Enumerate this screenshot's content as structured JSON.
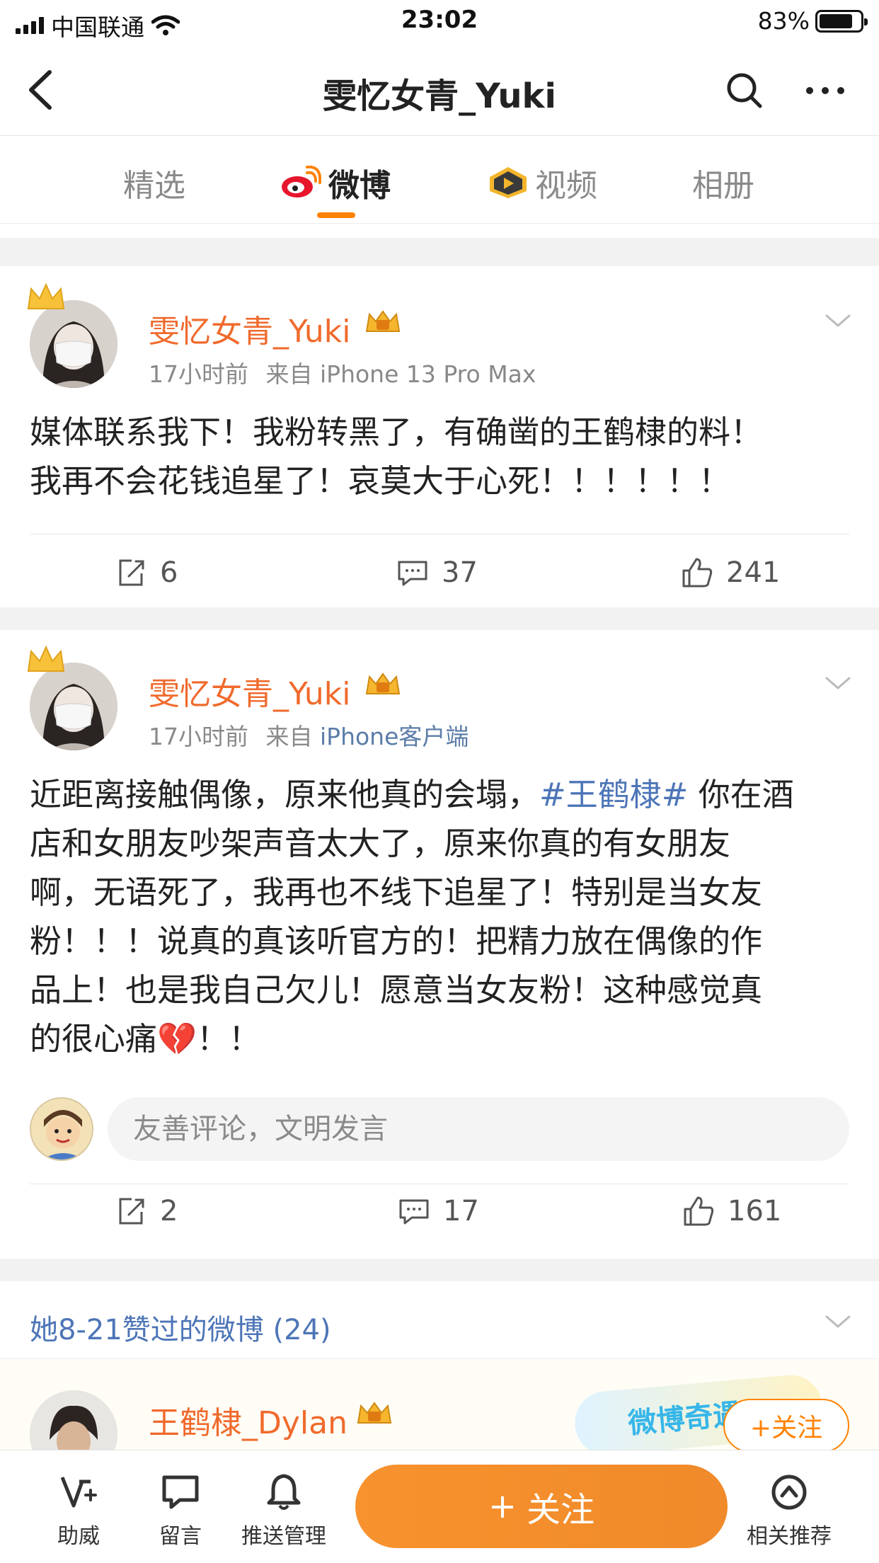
{
  "status_bar": {
    "carrier": "中国联通",
    "time": "23:02",
    "battery": "83%",
    "battery_level": 0.83
  },
  "header": {
    "title": "雯忆女青_Yuki"
  },
  "tabs": [
    {
      "label": "精选",
      "active": false
    },
    {
      "label": "微博",
      "active": true
    },
    {
      "label": "视频",
      "active": false
    },
    {
      "label": "相册",
      "active": false
    }
  ],
  "posts": [
    {
      "author": "雯忆女青_Yuki",
      "time": "17小时前",
      "source_prefix": "来自",
      "source": "iPhone 13 Pro Max",
      "text_lines": [
        "媒体联系我下！我粉转黑了，有确凿的王鹤棣的料！",
        "我再不会花钱追星了！哀莫大于心死！！！！！！"
      ],
      "reposts": "6",
      "comments": "37",
      "likes": "241"
    },
    {
      "author": "雯忆女青_Yuki",
      "time": "17小时前",
      "source_prefix": "来自",
      "source": "iPhone客户端",
      "text_lines": [
        "近距离接触偶像，原来他真的会塌，",
        "#王鹤棣#",
        " 你在酒",
        "店和女朋友吵架声音太大了，原来你真的有女朋友",
        "啊，无语死了，我再也不线下追星了！特别是当女友",
        "粉！！！说真的真该听官方的！把精力放在偶像的作",
        "品上！也是我自己欠儿！愿意当女友粉！这种感觉真",
        "的很心痛",
        "💔",
        "！！"
      ],
      "comment_placeholder": "友善评论，文明发言",
      "reposts": "2",
      "comments": "17",
      "likes": "161"
    }
  ],
  "liked_section": {
    "header": "她8-21赞过的微博 (24)",
    "author": "王鹤棣_Dylan",
    "badge": "微博奇遇记",
    "follow_label": "+关注"
  },
  "bottom_bar": {
    "items": [
      "助威",
      "留言",
      "推送管理",
      "相关推荐"
    ],
    "follow_plus": "+",
    "follow_label": "关注"
  },
  "colors": {
    "accent": "#ff8200",
    "name": "#f06a2c",
    "link": "#4d75b7"
  },
  "icons": [
    "back-icon",
    "search-icon",
    "more-icon",
    "weibo-icon",
    "video-icon",
    "crown-icon",
    "vip-icon",
    "chevron-down-icon",
    "repost-icon",
    "comment-icon",
    "like-icon",
    "cheer-icon",
    "message-icon",
    "bell-icon",
    "recommend-icon"
  ]
}
